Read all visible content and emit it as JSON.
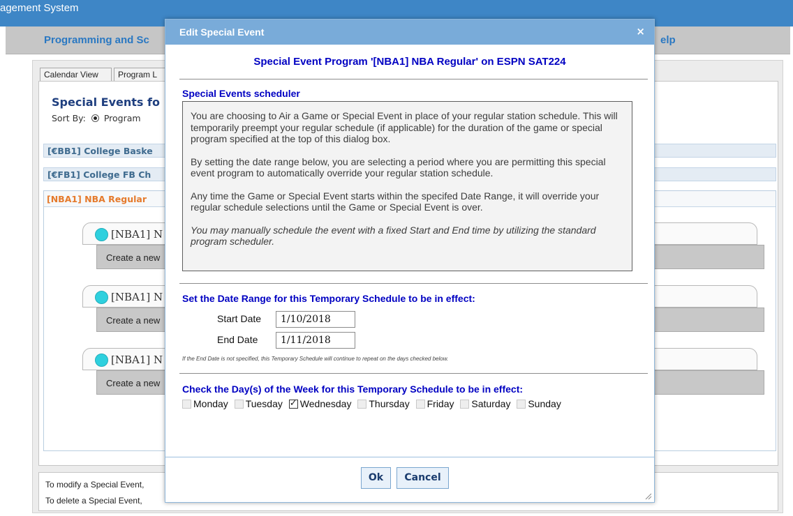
{
  "app": {
    "title": "agement System",
    "menu": {
      "programming": "Programming and Sc",
      "help": "elp"
    },
    "tabs": [
      {
        "label": "Calendar View"
      },
      {
        "label": "Program L"
      }
    ],
    "panel": {
      "heading": "Special Events fo",
      "sort_by_label": "Sort By:",
      "sort_option": "Program"
    },
    "groups": [
      {
        "label": "[€BB1] College Baske"
      },
      {
        "label": "[€FB1] College FB Ch"
      },
      {
        "label": "[NBA1] NBA Regular"
      }
    ],
    "events": [
      {
        "title": "[NBA1] N",
        "body": "Create a new"
      },
      {
        "title": "[NBA1] N",
        "body": "Create a new"
      },
      {
        "title": "[NBA1] N",
        "body": "Create a new"
      }
    ],
    "footer": {
      "line1": "To modify a Special Event,",
      "line2": "To delete a Special Event,"
    }
  },
  "dialog": {
    "title": "Edit Special Event",
    "close_icon": "×",
    "program_title": "Special Event Program '[NBA1] NBA Regular' on ESPN SAT224",
    "scheduler_heading": "Special Events scheduler",
    "info": {
      "p1": "You are choosing to Air a Game or Special Event in place of your regular station schedule. This will temporarily preempt your regular schedule (if applicable) for the duration of the game or special program specified at the top of this dialog box.",
      "p2": "By setting the date range below, you are selecting a period where you are permitting this special event program to automatically override your regular station schedule.",
      "p3": "Any time the Game or Special Event starts within the specifed Date Range, it will override your regular schedule selections until the Game or Special Event is over.",
      "p4": "You may manually schedule the event with a fixed Start and End time by utilizing the standard program scheduler."
    },
    "date_range_heading": "Set the Date Range for this Temporary Schedule to be in effect:",
    "start_date": {
      "label": "Start Date",
      "value": "1/10/2018"
    },
    "end_date": {
      "label": "End Date",
      "value": "1/11/2018"
    },
    "end_date_note": "If the End Date is not specified, this Temporary Schedule will continue to repeat on the days checked below.",
    "days_heading": "Check the Day(s) of the Week for this Temporary Schedule to be in effect:",
    "days": [
      {
        "label": "Monday",
        "checked": false
      },
      {
        "label": "Tuesday",
        "checked": false
      },
      {
        "label": "Wednesday",
        "checked": true
      },
      {
        "label": "Thursday",
        "checked": false
      },
      {
        "label": "Friday",
        "checked": false
      },
      {
        "label": "Saturday",
        "checked": false
      },
      {
        "label": "Sunday",
        "checked": false
      }
    ],
    "buttons": {
      "ok": "Ok",
      "cancel": "Cancel"
    }
  },
  "colors": {
    "title_bar": "#3e86c6",
    "dialog_title_bar": "#79abd9",
    "heading_blue": "#0000c2",
    "group_orange": "#e57a2c",
    "event_dot": "#2ed0de"
  }
}
